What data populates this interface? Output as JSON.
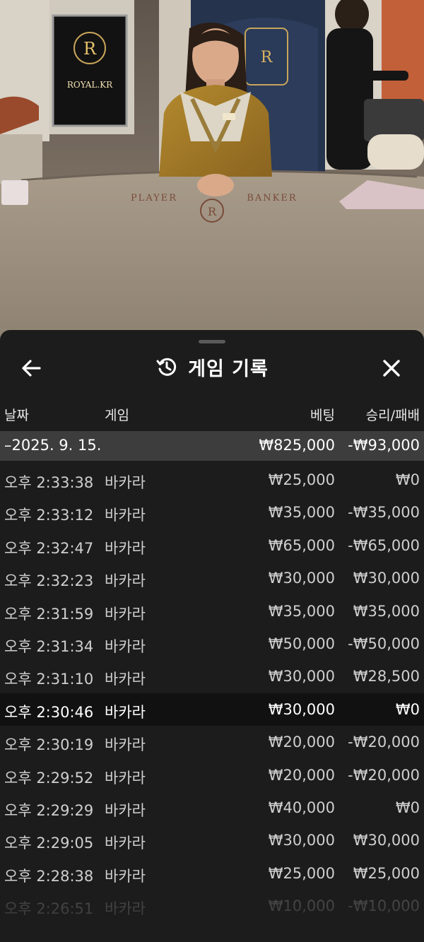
{
  "stream": {
    "logo_text": "ROYAL.KR",
    "logo_letter": "R",
    "table_labels": {
      "player": "PLAYER",
      "banker": "BANKER"
    }
  },
  "sheet": {
    "title": "게임 기록",
    "back_icon": "arrow-left-icon",
    "close_icon": "close-icon",
    "title_icon": "history-icon"
  },
  "columns": {
    "date": "날짜",
    "game": "게임",
    "bet": "베팅",
    "result": "승리/패배"
  },
  "day_summary": {
    "date": "–2025. 9. 15.",
    "bet": "₩825,000",
    "result": "-₩93,000"
  },
  "rows": [
    {
      "time": "오후 2:33:38",
      "game": "바카라",
      "bet": "₩25,000",
      "result": "₩0"
    },
    {
      "time": "오후 2:33:12",
      "game": "바카라",
      "bet": "₩35,000",
      "result": "-₩35,000"
    },
    {
      "time": "오후 2:32:47",
      "game": "바카라",
      "bet": "₩65,000",
      "result": "-₩65,000"
    },
    {
      "time": "오후 2:32:23",
      "game": "바카라",
      "bet": "₩30,000",
      "result": "₩30,000"
    },
    {
      "time": "오후 2:31:59",
      "game": "바카라",
      "bet": "₩35,000",
      "result": "₩35,000"
    },
    {
      "time": "오후 2:31:34",
      "game": "바카라",
      "bet": "₩50,000",
      "result": "-₩50,000"
    },
    {
      "time": "오후 2:31:10",
      "game": "바카라",
      "bet": "₩30,000",
      "result": "₩28,500"
    },
    {
      "time": "오후 2:30:46",
      "game": "바카라",
      "bet": "₩30,000",
      "result": "₩0"
    },
    {
      "time": "오후 2:30:19",
      "game": "바카라",
      "bet": "₩20,000",
      "result": "-₩20,000"
    },
    {
      "time": "오후 2:29:52",
      "game": "바카라",
      "bet": "₩20,000",
      "result": "-₩20,000"
    },
    {
      "time": "오후 2:29:29",
      "game": "바카라",
      "bet": "₩40,000",
      "result": "₩0"
    },
    {
      "time": "오후 2:29:05",
      "game": "바카라",
      "bet": "₩30,000",
      "result": "₩30,000"
    },
    {
      "time": "오후 2:28:38",
      "game": "바카라",
      "bet": "₩25,000",
      "result": "₩25,000"
    },
    {
      "time": "오후 2:26:51",
      "game": "바카라",
      "bet": "₩10,000",
      "result": "-₩10,000"
    }
  ],
  "highlighted_row_index": 7,
  "colors": {
    "sheet_bg": "#1c1c1c",
    "day_row_bg": "#3d3d3d",
    "highlight_row_bg": "#111111",
    "text_primary": "#ffffff",
    "text_secondary": "#cfcfcf"
  }
}
